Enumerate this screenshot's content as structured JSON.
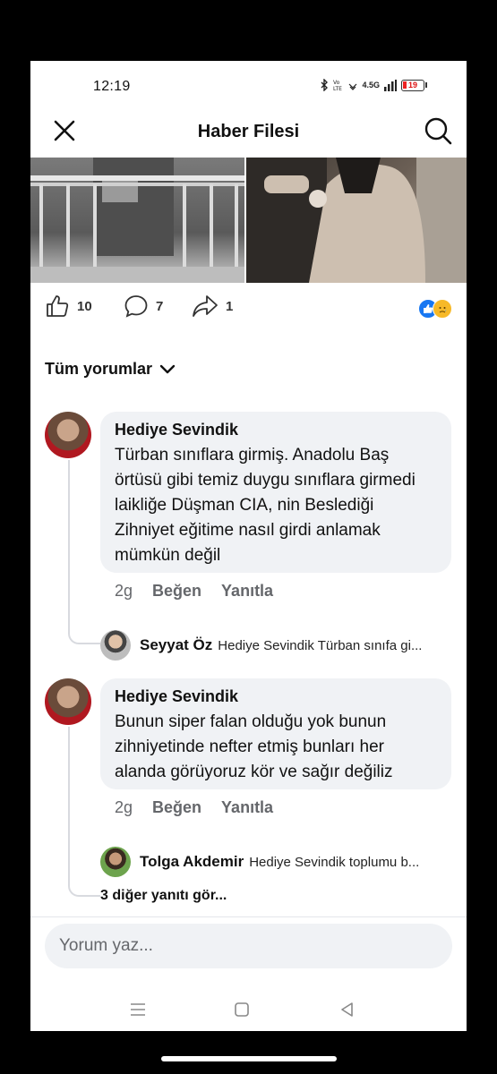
{
  "status_bar": {
    "time": "12:19",
    "network": "4.5G",
    "battery": "19"
  },
  "header": {
    "title": "Haber Filesi"
  },
  "post_actions": {
    "likes": "10",
    "comments": "7",
    "shares": "1"
  },
  "comments_filter": {
    "label": "Tüm yorumlar"
  },
  "comments": [
    {
      "author": "Hediye Sevindik",
      "text": "Türban sınıflara girmiş. Anadolu Baş örtüsü gibi temiz duygu sınıflara girmedi laikliğe Düşman CIA, nin Beslediği Zihniyet eğitime nasıl girdi anlamak mümkün değil",
      "time": "2g",
      "like_label": "Beğen",
      "reply_label": "Yanıtla",
      "reply": {
        "author": "Seyyat Öz",
        "text": "Hediye Sevindik Türban sınıfa gi..."
      }
    },
    {
      "author": "Hediye Sevindik",
      "text": "Bunun siper falan olduğu yok bunun zihniyetinde nefter etmiş bunları  her alanda görüyoruz kör ve sağır değiliz",
      "time": "2g",
      "like_label": "Beğen",
      "reply_label": "Yanıtla",
      "reply": {
        "author": "Tolga Akdemir",
        "text": "Hediye Sevindik toplumu b..."
      },
      "more_replies": "3 diğer yanıtı gör..."
    }
  ],
  "composer": {
    "placeholder": "Yorum yaz..."
  },
  "colors": {
    "like_blue": "#1877f2",
    "sad_yellow": "#f7b928",
    "bubble_bg": "#f0f2f5",
    "meta_gray": "#65676b"
  }
}
